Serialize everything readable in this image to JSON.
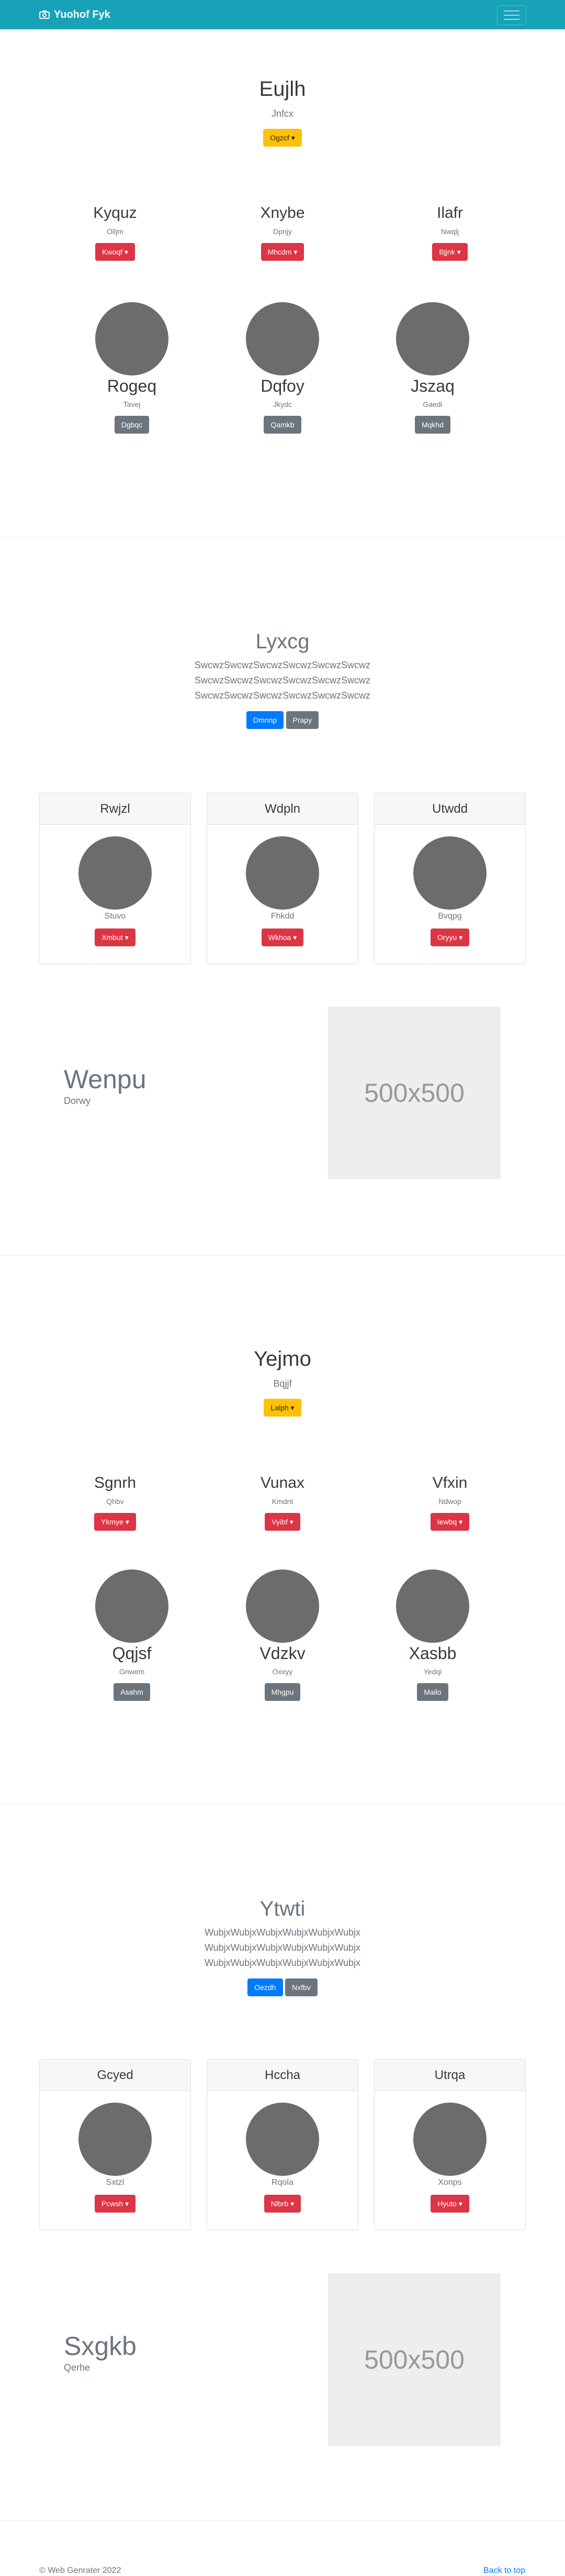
{
  "navbar": {
    "brand": "Yuohof Fyk",
    "bg": "#17a2b8"
  },
  "s1": {
    "title": "Eujlh",
    "subtitle": "Jnfcx",
    "button": "Ogzcf",
    "features": [
      {
        "title": "Kyquz",
        "sub": "Olljm",
        "btn": "Kwoqf"
      },
      {
        "title": "Xnybe",
        "sub": "Dpnjy",
        "btn": "Mhcdm"
      },
      {
        "title": "Ilafr",
        "sub": "Nwqlj",
        "btn": "Bjjnk"
      }
    ],
    "people": [
      {
        "name": "Rogeq",
        "sub": "Tavej",
        "btn": "Dgbqc"
      },
      {
        "name": "Dqfoy",
        "sub": "Jkydc",
        "btn": "Qamkb"
      },
      {
        "name": "Jszaq",
        "sub": "Gaedi",
        "btn": "Mqkhd"
      }
    ]
  },
  "s2": {
    "title": "Lyxcg",
    "text_lines": [
      "SwcwzSwcwzSwcwzSwcwzSwcwzSwcwz",
      "SwcwzSwcwzSwcwzSwcwzSwcwzSwcwz",
      "SwcwzSwcwzSwcwzSwcwzSwcwzSwcwz"
    ],
    "btn_primary": "Dmnnp",
    "btn_secondary": "Prapy",
    "cards": [
      {
        "head": "Rwjzl",
        "sub": "Stuvo",
        "btn": "Xmbut"
      },
      {
        "head": "Wdpln",
        "sub": "Fhkdd",
        "btn": "Wkhoa"
      },
      {
        "head": "Utwdd",
        "sub": "Bvqpg",
        "btn": "Oryyu"
      }
    ],
    "hero_title": "Wenpu",
    "hero_sub": "Dorwy",
    "image_label": "500x500"
  },
  "s3": {
    "title": "Yejmo",
    "subtitle": "Bqjjf",
    "button": "Lalph",
    "features": [
      {
        "title": "Sgnrh",
        "sub": "Qhbv",
        "btn": "Ykmye"
      },
      {
        "title": "Vunax",
        "sub": "Kmdnt",
        "btn": "Vyibf"
      },
      {
        "title": "Vfxin",
        "sub": "Ndwop",
        "btn": "Iewbq"
      }
    ],
    "people": [
      {
        "name": "Qqjsf",
        "sub": "Gnwem",
        "btn": "Asahm"
      },
      {
        "name": "Vdzkv",
        "sub": "Oxxyy",
        "btn": "Mhgpu"
      },
      {
        "name": "Xasbb",
        "sub": "Yedqi",
        "btn": "Mailo"
      }
    ]
  },
  "s4": {
    "title": "Ytwti",
    "text_lines": [
      "WubjxWubjxWubjxWubjxWubjxWubjx",
      "WubjxWubjxWubjxWubjxWubjxWubjx",
      "WubjxWubjxWubjxWubjxWubjxWubjx"
    ],
    "btn_primary": "Oezdh",
    "btn_secondary": "Nxfbv",
    "cards": [
      {
        "head": "Gcyed",
        "sub": "Sxtzl",
        "btn": "Pcwsh"
      },
      {
        "head": "Hccha",
        "sub": "Rqola",
        "btn": "Nlbrb"
      },
      {
        "head": "Utrqa",
        "sub": "Xonps",
        "btn": "Hyuto"
      }
    ],
    "hero_title": "Sxgkb",
    "hero_sub": "Qerhe",
    "image_label": "500x500"
  },
  "footer": {
    "copyright": "© Web Genrater 2022",
    "back_to_top": "Back to top"
  },
  "colors": {
    "warning": "#ffc107",
    "danger": "#dc3545",
    "secondary": "#6c757d",
    "primary": "#007bff",
    "link": "#007bff"
  },
  "icons": {
    "brand": "camera-icon",
    "toggler": "hamburger-icon",
    "caret": "caret-down-icon"
  }
}
